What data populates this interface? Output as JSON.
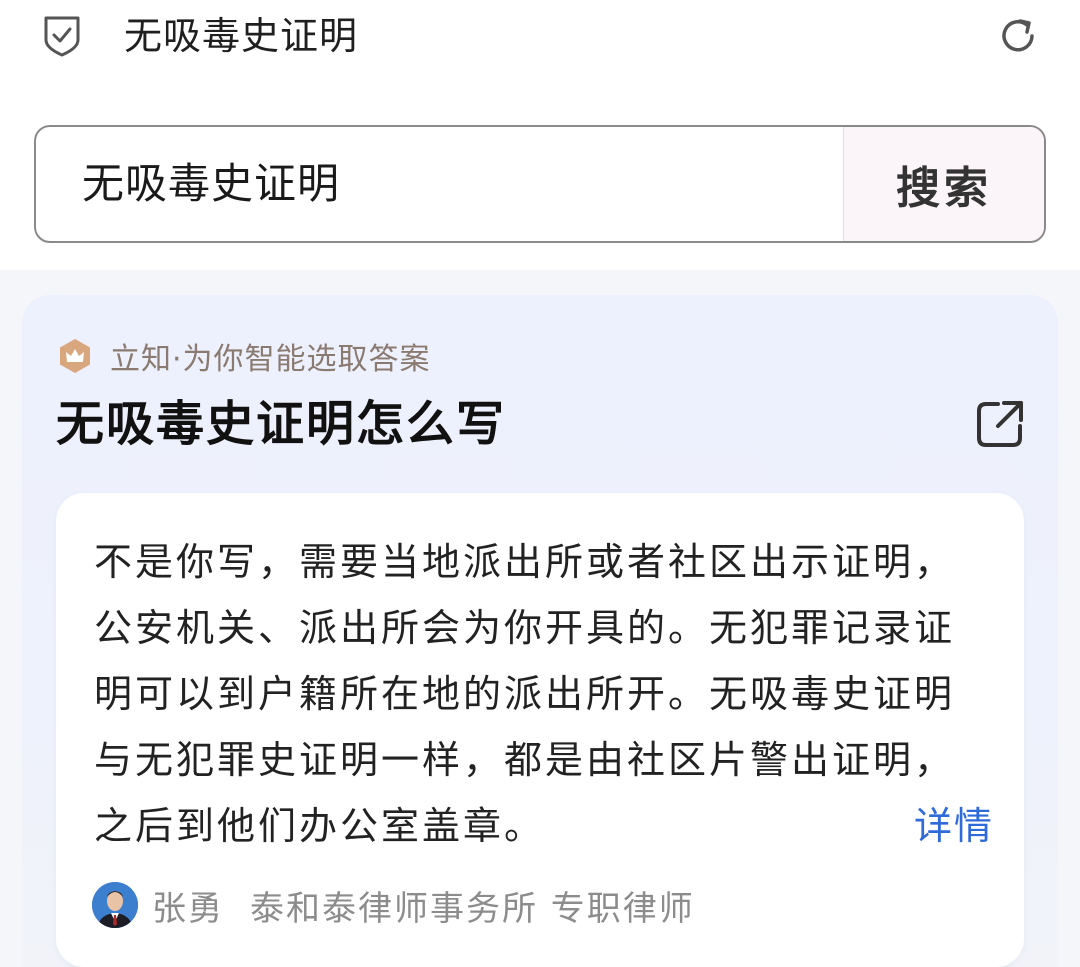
{
  "header": {
    "title": "无吸毒史证明",
    "shield_icon": "shield-check-icon",
    "refresh_icon": "refresh-icon"
  },
  "search": {
    "query": "无吸毒史证明",
    "button_label": "搜索"
  },
  "result": {
    "source_label": "立知·为你智能选取答案",
    "source_icon": "crown-icon",
    "question": "无吸毒史证明怎么写",
    "share_icon": "external-link-icon",
    "answer": "不是你写，需要当地派出所或者社区出示证明，公安机关、派出所会为你开具的。无犯罪记录证明可以到户籍所在地的派出所开。无吸毒史证明与无犯罪史证明一样，都是由社区片警出证明，之后到他们办公室盖章。",
    "detail_link": "详情",
    "author": {
      "name": "张勇",
      "organization": "泰和泰律师事务所 专职律师"
    }
  },
  "colors": {
    "accent_link": "#2f6ad9",
    "source_text": "#8a7a70",
    "card_bg": "#eef1fc"
  }
}
